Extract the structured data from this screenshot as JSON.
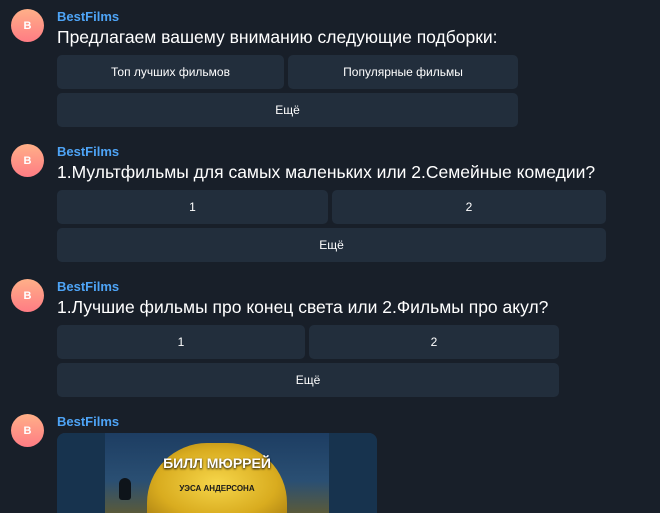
{
  "colors": {
    "background": "#181f29",
    "sender": "#4ea4f6",
    "button": "#222e3c"
  },
  "messages": [
    {
      "avatar_letter": "B",
      "sender": "BestFilms",
      "text": "Предлагаем вашему вниманию следующие подборки:",
      "buttons": [
        "Топ лучших фильмов",
        "Популярные фильмы",
        "Ещё"
      ]
    },
    {
      "avatar_letter": "B",
      "sender": "BestFilms",
      "text": "1.Мультфильмы для самых маленьких или 2.Семейные комедии?",
      "buttons": [
        "1",
        "2",
        "Ещё"
      ]
    },
    {
      "avatar_letter": "B",
      "sender": "BestFilms",
      "text": "1.Лучшие фильмы про конец света или 2.Фильмы про акул?",
      "buttons": [
        "1",
        "2",
        "Ещё"
      ]
    },
    {
      "avatar_letter": "B",
      "sender": "BestFilms",
      "poster": {
        "title": "БИЛЛ МЮРРЕЙ",
        "subtitle": "УЭСА АНДЕРСОНА"
      }
    }
  ]
}
